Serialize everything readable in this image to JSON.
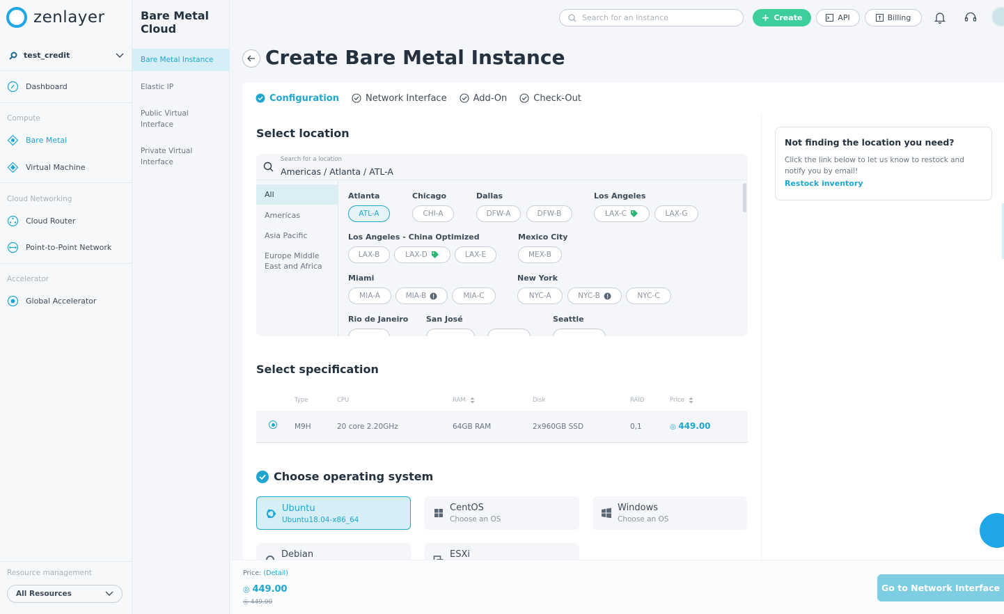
{
  "app": {
    "brand": "zenlayer"
  },
  "account": {
    "name": "test_credit"
  },
  "sidebar": {
    "dashboard": "Dashboard",
    "categories": {
      "compute": "Compute",
      "networking": "Cloud Networking",
      "accelerator": "Accelerator"
    },
    "items": {
      "bare_metal": "Bare Metal",
      "virtual_machine": "Virtual Machine",
      "cloud_router": "Cloud Router",
      "p2p": "Point-to-Point Network",
      "global_accelerator": "Global Accelerator"
    },
    "resource_label": "Resource management",
    "resource_value": "All Resources"
  },
  "subnav": {
    "title": "Bare Metal Cloud",
    "items": [
      "Bare Metal Instance",
      "Elastic IP",
      "Public Virtual Interface",
      "Private Virtual Interface"
    ]
  },
  "header": {
    "search_placeholder": "Search for an Instance",
    "create": "Create",
    "api": "API",
    "billing": "Billing"
  },
  "page": {
    "title": "Create Bare Metal Instance"
  },
  "steps": [
    "Configuration",
    "Network Interface",
    "Add-On",
    "Check-Out"
  ],
  "location": {
    "section_title": "Select location",
    "search_placeholder": "Search for a location",
    "search_value": "Americas / Atlanta / ATL-A",
    "regions": [
      "All",
      "Americas",
      "Asia Pacific",
      "Europe Middle East and Africa"
    ],
    "cities": {
      "atlanta": {
        "name": "Atlanta",
        "zones": [
          "ATL-A"
        ]
      },
      "chicago": {
        "name": "Chicago",
        "zones": [
          "CHI-A"
        ]
      },
      "dallas": {
        "name": "Dallas",
        "zones": [
          "DFW-A",
          "DFW-B"
        ]
      },
      "los_angeles": {
        "name": "Los Angeles",
        "zones": [
          "LAX-C",
          "LAX-G"
        ]
      },
      "la_china": {
        "name": "Los Angeles - China Optimized",
        "zones": [
          "LAX-B",
          "LAX-D",
          "LAX-E"
        ]
      },
      "mexico": {
        "name": "Mexico City",
        "zones": [
          "MEX-B"
        ]
      },
      "miami": {
        "name": "Miami",
        "zones": [
          "MIA-A",
          "MIA-B",
          "MIA-C"
        ]
      },
      "new_york": {
        "name": "New York",
        "zones": [
          "NYC-A",
          "NYC-B",
          "NYC-C"
        ]
      },
      "rio": {
        "name": "Rio de Janeiro"
      },
      "san_jose": {
        "name": "San José"
      },
      "seattle": {
        "name": "Seattle"
      }
    }
  },
  "specification": {
    "section_title": "Select specification",
    "columns": [
      "Type",
      "CPU",
      "RAM",
      "Disk",
      "RAID",
      "Price"
    ],
    "rows": [
      {
        "type": "M9H",
        "cpu": "20 core 2.20GHz",
        "ram": "64GB RAM",
        "disk": "2x960GB SSD",
        "raid": "0,1",
        "price": "449.00"
      }
    ]
  },
  "os": {
    "section_title": "Choose operating system",
    "options": [
      {
        "name": "Ubuntu",
        "sub": "Ubuntu18.04-x86_64"
      },
      {
        "name": "CentOS",
        "sub": "Choose an OS"
      },
      {
        "name": "Windows",
        "sub": "Choose an OS"
      },
      {
        "name": "Debian"
      },
      {
        "name": "ESXi"
      }
    ]
  },
  "restock": {
    "title": "Not finding the location you need?",
    "desc": "Click the link below to let us know to restock and notify you by email!",
    "link": "Restock inventory"
  },
  "footer": {
    "price_label": "Price:",
    "detail_link": "(Detail)",
    "price": "449.00",
    "old_price": "449.00",
    "next_button": "Go to Network Interface"
  },
  "colors": {
    "accent": "#1fa6cf",
    "create": "#3ccf9c",
    "tag_green": "#2bb673"
  }
}
